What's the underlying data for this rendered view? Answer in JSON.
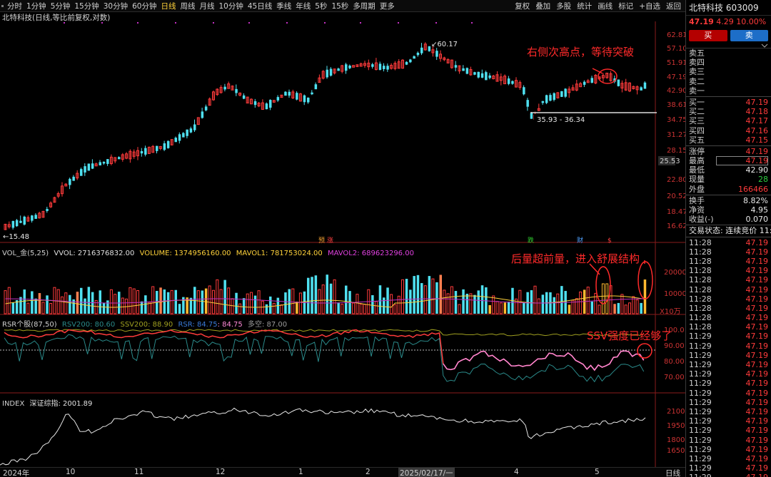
{
  "toolbar": {
    "periods": [
      "分时",
      "1分钟",
      "5分钟",
      "15分钟",
      "30分钟",
      "60分钟",
      "日线",
      "周线",
      "月线",
      "10分钟",
      "45日线",
      "季线",
      "年线",
      "5秒",
      "15秒",
      "多周期",
      "更多"
    ],
    "active_period": "日线",
    "tools": [
      "复权",
      "叠加",
      "多股",
      "统计",
      "画线",
      "标记",
      "+自选",
      "返回"
    ]
  },
  "chart_title": "北特科技(日线,等比前复权,对数)",
  "price_axis": {
    "labels": [
      "62.81",
      "57.10",
      "51.91",
      "47.19",
      "42.90",
      "38.61",
      "34.75",
      "31.27",
      "28.15",
      "25.53",
      "22.80",
      "20.52",
      "18.47",
      "16.62"
    ],
    "current_price_marker": "25.53"
  },
  "price_annotations": {
    "high": "60.17",
    "low": "15.48",
    "range": "35.93 - 36.34"
  },
  "event_marks": [
    "预",
    "涨",
    "跌",
    "财",
    "$"
  ],
  "vol_panel": {
    "name": "VOL_金(5,25)",
    "vvol": "VVOL: 2716376832.00",
    "volume": "VOLUME: 1374956160.00",
    "mavol1": "MAVOL1: 781753024.00",
    "mavol2": "MAVOL2: 689623296.00",
    "axis": [
      "20000",
      "10000"
    ],
    "unit": "X10万"
  },
  "rsr_panel": {
    "name": "RSR个股(87,50)",
    "rsv200": "RSV200: 80.60",
    "ssv200": "SSV200: 88.90",
    "rsr": "RSR: 84.75",
    "rsr2": ": 84.75",
    "duokong": "多空: 87.00",
    "axis": [
      "100.0",
      "90.00",
      "80.00",
      "70.00"
    ]
  },
  "index_panel": {
    "name": "INDEX",
    "value": "深证综指: 2001.89",
    "axis": [
      "2100",
      "1950",
      "1800",
      "1650"
    ]
  },
  "time_axis": {
    "labels": [
      "2024年",
      "10",
      "11",
      "12",
      "1",
      "2",
      "2025/02/17/一",
      "4",
      "5",
      "日线"
    ]
  },
  "annotations": {
    "top": "右侧次高点，等待突破",
    "mid": "后量超前量，进入舒展结构",
    "low": "SSV强度已经够了"
  },
  "quote": {
    "name": "北特科技",
    "code": "603009",
    "price": "47.19",
    "change": "4.29",
    "pct": "10.00%",
    "buy_label": "买",
    "sell_label": "卖",
    "asks": [
      {
        "label": "卖五",
        "price": "",
        "vol": ""
      },
      {
        "label": "卖四",
        "price": "",
        "vol": ""
      },
      {
        "label": "卖三",
        "price": "",
        "vol": ""
      },
      {
        "label": "卖二",
        "price": "",
        "vol": ""
      },
      {
        "label": "卖一",
        "price": "",
        "vol": ""
      }
    ],
    "bids": [
      {
        "label": "买一",
        "price": "47.19"
      },
      {
        "label": "买二",
        "price": "47.18"
      },
      {
        "label": "买三",
        "price": "47.17"
      },
      {
        "label": "买四",
        "price": "47.16"
      },
      {
        "label": "买五",
        "price": "47.15"
      }
    ],
    "stats": [
      {
        "label": "涨停",
        "value": "47.19",
        "color": "red"
      },
      {
        "label": "最高",
        "value": "47.19",
        "color": "red"
      },
      {
        "label": "最低",
        "value": "42.90",
        "color": "white"
      },
      {
        "label": "现量",
        "value": "28",
        "color": "green"
      },
      {
        "label": "外盘",
        "value": "166466",
        "color": "red"
      }
    ],
    "stats2": [
      {
        "label": "换手",
        "value": "8.82%",
        "color": "white"
      },
      {
        "label": "净资",
        "value": "4.95",
        "color": "white"
      },
      {
        "label": "收益(-)",
        "value": "0.070",
        "color": "white"
      }
    ],
    "trade_status": "交易状态: 连续竞价 11:29",
    "ticks": [
      {
        "t": "11:28",
        "p": "47.19"
      },
      {
        "t": "11:28",
        "p": "47.19"
      },
      {
        "t": "11:28",
        "p": "47.19"
      },
      {
        "t": "11:28",
        "p": "47.19"
      },
      {
        "t": "11:28",
        "p": "47.19"
      },
      {
        "t": "11:28",
        "p": "47.19"
      },
      {
        "t": "11:28",
        "p": "47.19"
      },
      {
        "t": "11:28",
        "p": "47.19"
      },
      {
        "t": "11:28",
        "p": "47.19"
      },
      {
        "t": "11:28",
        "p": "47.19"
      },
      {
        "t": "11:29",
        "p": "47.19"
      },
      {
        "t": "11:29",
        "p": "47.19"
      },
      {
        "t": "11:29",
        "p": "47.19"
      },
      {
        "t": "11:29",
        "p": "47.19"
      },
      {
        "t": "11:29",
        "p": "47.19"
      },
      {
        "t": "11:29",
        "p": "47.19"
      },
      {
        "t": "11:29",
        "p": "47.19"
      },
      {
        "t": "11:29",
        "p": "47.19"
      },
      {
        "t": "11:29",
        "p": "47.19"
      },
      {
        "t": "11:29",
        "p": "47.19"
      },
      {
        "t": "11:29",
        "p": "47.19"
      },
      {
        "t": "11:29",
        "p": "47.19"
      },
      {
        "t": "11:29",
        "p": "47.19"
      },
      {
        "t": "11:29",
        "p": "47.19"
      },
      {
        "t": "11:29",
        "p": "47.19"
      },
      {
        "t": "11:29",
        "p": "47.19"
      }
    ]
  }
}
